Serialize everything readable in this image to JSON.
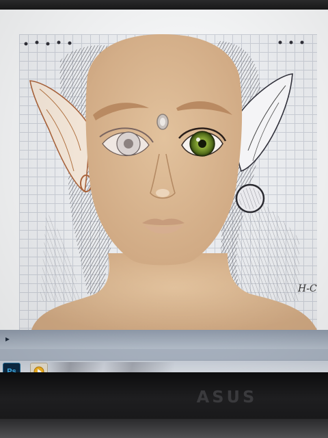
{
  "taskbar": {
    "apps": [
      {
        "label": "Ps",
        "icon": "photoshop-icon"
      },
      {
        "label": "",
        "icon": "media-player-icon"
      }
    ]
  },
  "canvas": {
    "signature": "H-C"
  },
  "monitor": {
    "brand": "ASUS"
  },
  "colors": {
    "skin": "#d9b690",
    "iris": "#6f8a2a",
    "grid_line": "#c8ccd4",
    "canvas_bg": "#e9ebee"
  }
}
